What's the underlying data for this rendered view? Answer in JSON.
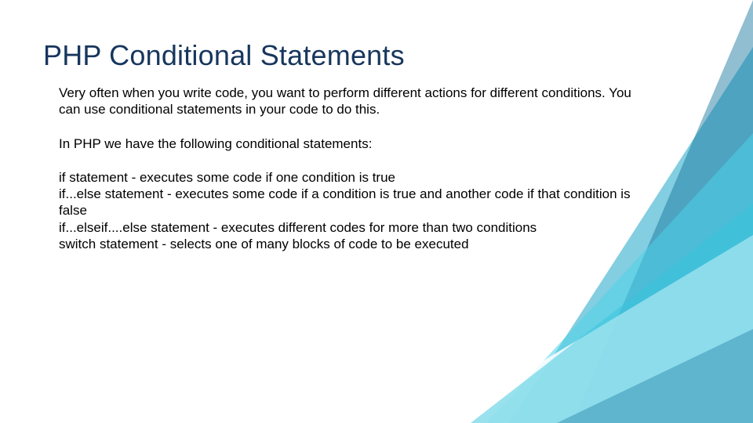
{
  "title": "PHP Conditional Statements",
  "intro1": "Very often when you write code, you want to perform different actions for different conditions. You can use conditional statements in your code to do this.",
  "intro2": "In PHP we have the following conditional statements:",
  "items": {
    "a": "if statement - executes some code if one condition is true",
    "b": "if...else statement - executes some code if a condition is true and another code if that condition is false",
    "c": "if...elseif....else statement - executes different codes for more than two conditions",
    "d": "switch statement - selects one of many blocks of code to be executed"
  }
}
